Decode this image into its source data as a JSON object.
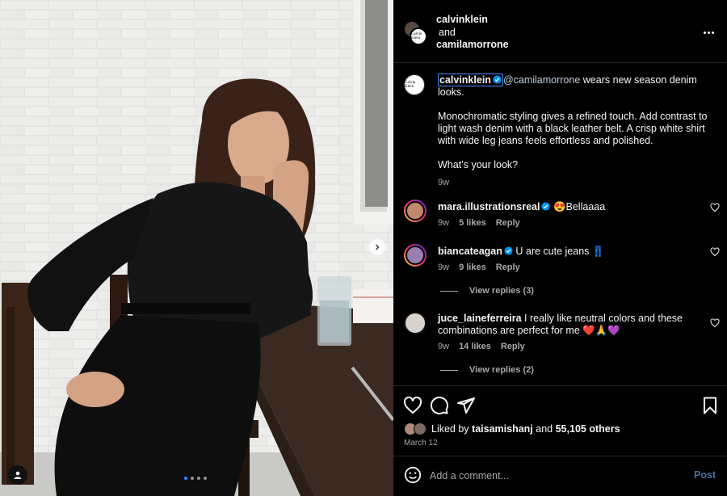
{
  "header": {
    "user1": "calvinklein",
    "joiner": "and",
    "user2": "camilamorrone",
    "more_icon": "more-horizontal-icon"
  },
  "caption": {
    "username": "calvinklein",
    "avatar_text": "Calvin Klein",
    "mention": "@camilamorrone",
    "text1": " wears new season denim looks.",
    "text2": "Monochromatic styling gives a refined touch. Add contrast to light wash denim with a black leather belt. A crisp white shirt with wide leg jeans feels effortless and polished.",
    "text3": "What’s your look?",
    "time": "9w"
  },
  "comments": [
    {
      "username": "mara.illustrationsreal",
      "verified": true,
      "text": "😍Bellaaaa",
      "time": "9w",
      "likes": "5 likes",
      "reply": "Reply"
    },
    {
      "username": "biancateagan",
      "verified": true,
      "text": "U are cute jeans 👖",
      "time": "9w",
      "likes": "9 likes",
      "reply": "Reply",
      "view_replies": "View replies (3)"
    },
    {
      "username": "juce_laineferreira",
      "verified": false,
      "text": "I really like neutral colors and these combinations are perfect for me ❤️🙏💜",
      "time": "9w",
      "likes": "14 likes",
      "reply": "Reply",
      "view_replies": "View replies (2)"
    }
  ],
  "actions": {
    "liked_prefix": "Liked by ",
    "liked_user": "taisamishanj",
    "liked_and": " and ",
    "liked_count": "55,105 others",
    "date": "March 12"
  },
  "composer": {
    "placeholder": "Add a comment...",
    "post_label": "Post"
  },
  "carousel": {
    "slide_count": 4,
    "active_slide": 1
  },
  "colors": {
    "accent": "#0095f6",
    "verified": "#0095f6",
    "background": "#000000"
  }
}
